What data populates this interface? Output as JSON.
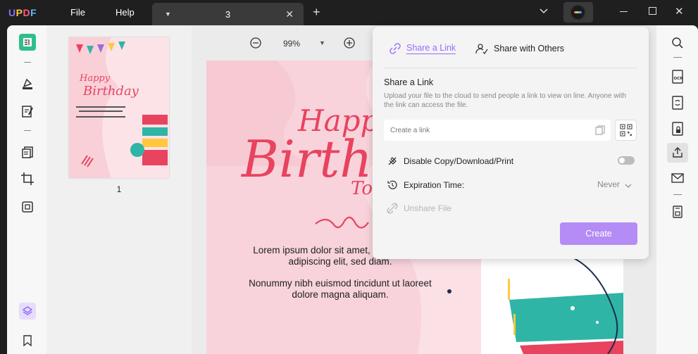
{
  "titlebar": {
    "logo": {
      "u": "U",
      "p": "P",
      "d": "D",
      "f": "F"
    },
    "menu": [
      "File",
      "Help"
    ],
    "tab_title": "3"
  },
  "viewer": {
    "zoom": "99%",
    "page_text_1": "Lorem ipsum dolor sit amet, consectetuer adipiscing elit, sed diam.",
    "page_text_2": "Nonummy nibh euismod tincidunt ut laoreet dolore magna aliquam."
  },
  "thumbnails": [
    {
      "page": "1"
    }
  ],
  "share_panel": {
    "tab_link": "Share a Link",
    "tab_others": "Share with Others",
    "heading": "Share a Link",
    "description": "Upload your file to the cloud to send people a link to view on line. Anyone with the link can access the file.",
    "link_placeholder": "Create a link",
    "disable_copy_label": "Disable Copy/Download/Print",
    "expiration_label": "Expiration Time:",
    "expiration_value": "Never",
    "unshare_label": "Unshare File",
    "create_label": "Create"
  },
  "colors": {
    "accent": "#9a6bff",
    "create_button": "#b58cf5",
    "page_bg": "#fbe0e6",
    "title_red": "#e8435f"
  }
}
